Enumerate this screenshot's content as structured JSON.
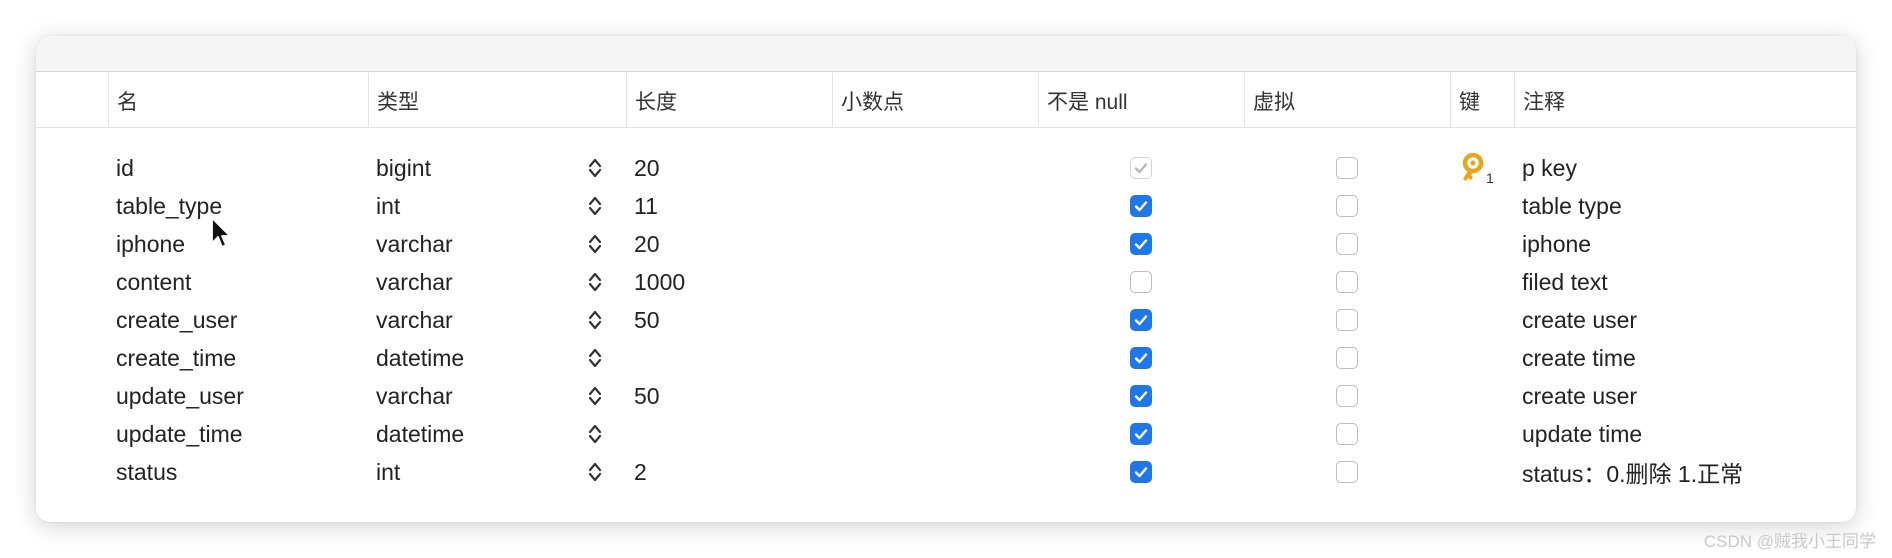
{
  "columns": {
    "name": "名",
    "type": "类型",
    "length": "长度",
    "decimal": "小数点",
    "not_null": "不是 null",
    "virtual": "虚拟",
    "key": "键",
    "comment": "注释"
  },
  "rows": [
    {
      "name": "id",
      "type": "bigint",
      "length": "20",
      "not_null": true,
      "not_null_disabled": true,
      "virtual": false,
      "key": true,
      "comment": "p key"
    },
    {
      "name": "table_type",
      "type": "int",
      "length": "11",
      "not_null": true,
      "virtual": false,
      "key": false,
      "comment": "table type"
    },
    {
      "name": "iphone",
      "type": "varchar",
      "length": "20",
      "not_null": true,
      "virtual": false,
      "key": false,
      "comment": "iphone"
    },
    {
      "name": "content",
      "type": "varchar",
      "length": "1000",
      "not_null": false,
      "virtual": false,
      "key": false,
      "comment": "filed text"
    },
    {
      "name": "create_user",
      "type": "varchar",
      "length": "50",
      "not_null": true,
      "virtual": false,
      "key": false,
      "comment": "create user"
    },
    {
      "name": "create_time",
      "type": "datetime",
      "length": "",
      "not_null": true,
      "virtual": false,
      "key": false,
      "comment": "create time"
    },
    {
      "name": "update_user",
      "type": "varchar",
      "length": "50",
      "not_null": true,
      "virtual": false,
      "key": false,
      "comment": "create user"
    },
    {
      "name": "update_time",
      "type": "datetime",
      "length": "",
      "not_null": true,
      "virtual": false,
      "key": false,
      "comment": "update time"
    },
    {
      "name": "status",
      "type": "int",
      "length": "2",
      "not_null": true,
      "virtual": false,
      "key": false,
      "comment": "status：0.删除 1.正常"
    }
  ],
  "watermark": "CSDN @贼我小王同学",
  "colors": {
    "checkbox_on": "#1f78e6",
    "key_icon": "#e8a41c"
  },
  "icons": {
    "stepper": "up-down-chevron-icon",
    "key": "key-icon",
    "cursor": "mouse-pointer-icon"
  }
}
